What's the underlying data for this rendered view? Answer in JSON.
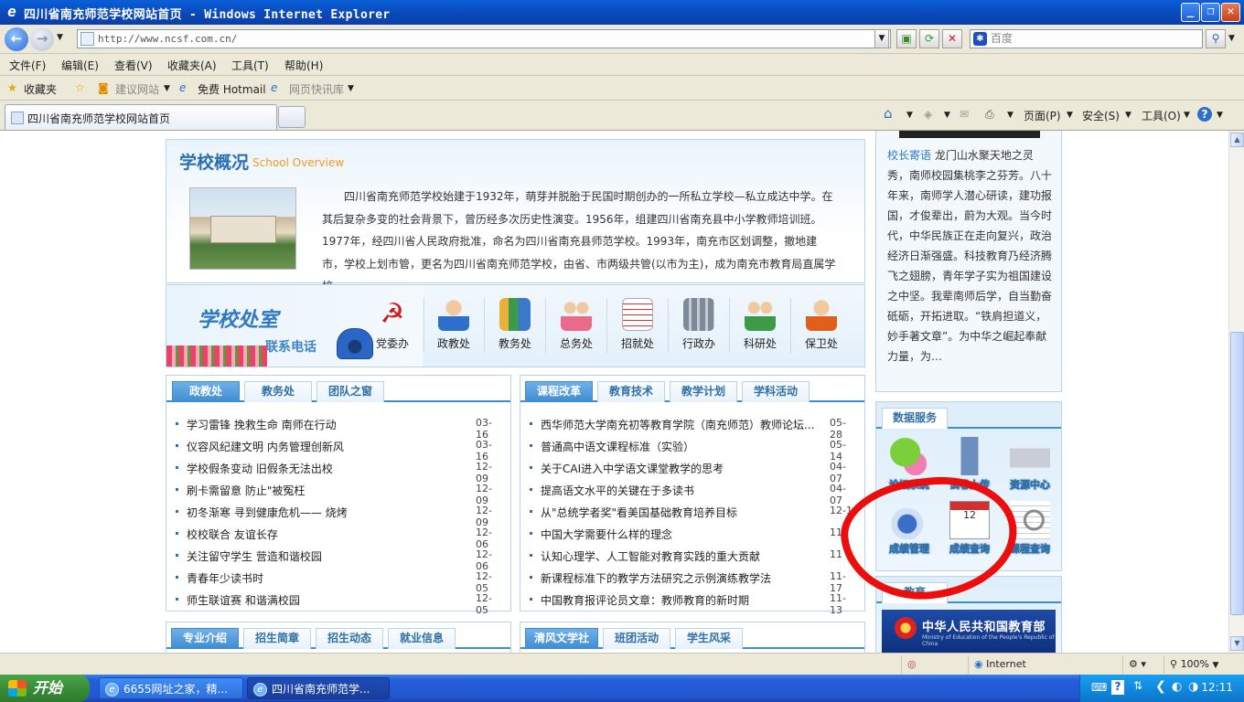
{
  "window": {
    "title": "四川省南充师范学校网站首页 - Windows Internet Explorer",
    "min_glyph": "_",
    "max_glyph": "❐",
    "close_glyph": "✕"
  },
  "address": {
    "url": "http://www.ncsf.com.cn/",
    "search_placeholder": "百度"
  },
  "menu": [
    "文件(F)",
    "编辑(E)",
    "查看(V)",
    "收藏夹(A)",
    "工具(T)",
    "帮助(H)"
  ],
  "favorites": {
    "favorites_label": "收藏夹",
    "suggested": "建议网站",
    "hotmail": "免费 Hotmail",
    "webslice": "网页快讯库"
  },
  "tabs": {
    "current": "四川省南充师范学校网站首页"
  },
  "commandbar": {
    "page": "页面(P)",
    "safety": "安全(S)",
    "tools": "工具(O)",
    "help": "?"
  },
  "overview": {
    "title": "学校概况",
    "subtitle": "School Overview",
    "text": "四川省南充师范学校始建于1932年，萌芽并脱胎于民国时期创办的一所私立学校—私立成达中学。在其后复杂多变的社会背景下，曾历经多次历史性演变。1956年，组建四川省南充县中小学教师培训班。1977年，经四川省人民政府批准，命名为四川省南充县师范学校。1993年，南充市区划调整，撤地建市，学校上划市管，更名为四川省南充师范学校，由省、市两级共管(以市为主)，成为南充市教育局直属学校…"
  },
  "offices": {
    "title": "学校处室",
    "phone_label": "联系电话",
    "items": [
      "党委办",
      "政教处",
      "教务处",
      "总务处",
      "招就处",
      "行政办",
      "科研处",
      "保卫处"
    ]
  },
  "panel_left": {
    "tabs": [
      "政教处",
      "教务处",
      "团队之窗"
    ],
    "news": [
      {
        "title": "学习雷锋 挽救生命 南师在行动",
        "date": "03-16"
      },
      {
        "title": "仪容风纪建文明 内务管理创新风",
        "date": "03-16"
      },
      {
        "title": "学校假条变动 旧假条无法出校",
        "date": "12-09"
      },
      {
        "title": "刷卡需留意 防止\"被冤枉",
        "date": "12-09"
      },
      {
        "title": "初冬渐寒 寻到健康危机—— 烧烤",
        "date": "12-09"
      },
      {
        "title": "校校联合 友谊长存",
        "date": "12-06"
      },
      {
        "title": "关注留守学生 营造和谐校园",
        "date": "12-06"
      },
      {
        "title": "青春年少读书时",
        "date": "12-05"
      },
      {
        "title": "师生联谊赛 和谐满校园",
        "date": "12-05"
      }
    ]
  },
  "panel_right": {
    "tabs": [
      "课程改革",
      "教育技术",
      "教学计划",
      "学科活动"
    ],
    "news": [
      {
        "title": "西华师范大学南充初等教育学院（南充师范）教师论坛...",
        "date": "05-28"
      },
      {
        "title": "普通高中语文课程标准（实验）",
        "date": "05-14"
      },
      {
        "title": "关于CAI进入中学语文课堂教学的思考",
        "date": "04-07"
      },
      {
        "title": "提高语文水平的关键在于多读书",
        "date": "04-07"
      },
      {
        "title": "从\"总统学者奖\"看美国基础教育培养目标",
        "date": "12-1"
      },
      {
        "title": "中国大学需要什么样的理念",
        "date": "11"
      },
      {
        "title": "认知心理学、人工智能对教育实践的重大贡献",
        "date": "11"
      },
      {
        "title": "新课程标准下的教学方法研究之示例演练教学法",
        "date": "11-17"
      },
      {
        "title": "中国教育报评论员文章：教师教育的新时期",
        "date": "11-13"
      }
    ]
  },
  "bottom_left": {
    "tabs": [
      "专业介绍",
      "招生简章",
      "招生动态",
      "就业信息"
    ]
  },
  "bottom_right": {
    "tabs": [
      "清风文学社",
      "班团活动",
      "学生风采"
    ]
  },
  "principal": {
    "heading": "校长寄语",
    "text": "龙门山水聚天地之灵秀，南师校园集桃李之芬芳。八十年来，南师学人潜心研读，建功报国，才俊辈出，蔚为大观。当今时代，中华民族正在走向复兴，政治经济日渐强盛。科技教育乃经济腾飞之翅膀，青年学子实为祖国建设之中坚。我辈南师后学，自当勤奋砥砺，开拓进取。“铁肩担道义，妙手著文章”。为中华之崛起奉献力量，为…"
  },
  "data_service": {
    "title": "数据服务",
    "items": [
      "论坛系统",
      "试卷上传",
      "资源中心",
      "成绩管理",
      "成绩查询",
      "课程查询"
    ]
  },
  "edu_links": {
    "title": "教育",
    "banner_text": "中华人民共和国教育部",
    "banner_sub": "Ministry of Education of the People's Republic of China"
  },
  "status": {
    "zone": "Internet",
    "zoom": "100%"
  },
  "taskbar": {
    "start": "开始",
    "items": [
      "6655网址之家，精...",
      "四川省南充师范学..."
    ],
    "clock": "12:11"
  }
}
